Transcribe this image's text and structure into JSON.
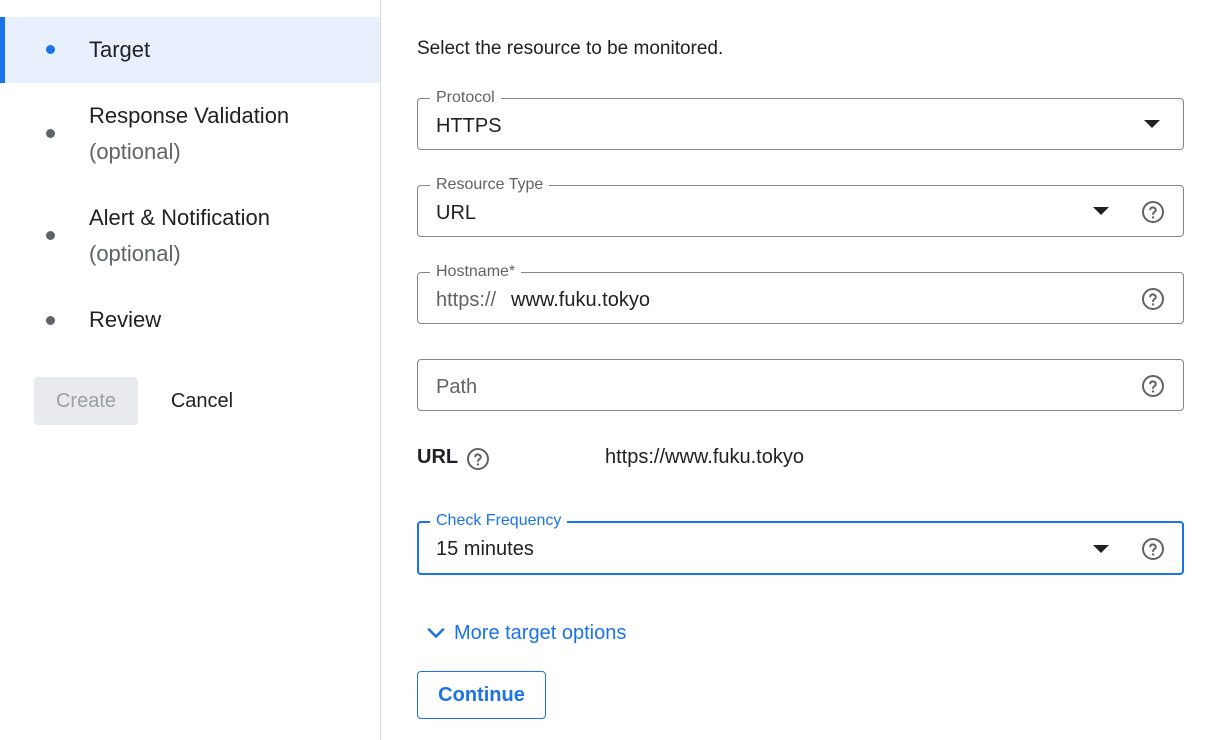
{
  "sidebar": {
    "steps": [
      {
        "title": "Target",
        "subtitle": ""
      },
      {
        "title": "Response Validation",
        "subtitle": "(optional)"
      },
      {
        "title": "Alert & Notification",
        "subtitle": "(optional)"
      },
      {
        "title": "Review",
        "subtitle": ""
      }
    ],
    "create_label": "Create",
    "cancel_label": "Cancel"
  },
  "main": {
    "intro": "Select the resource to be monitored.",
    "protocol": {
      "label": "Protocol",
      "value": "HTTPS"
    },
    "resource_type": {
      "label": "Resource Type",
      "value": "URL"
    },
    "hostname": {
      "label": "Hostname*",
      "prefix": "https://",
      "value": "www.fuku.tokyo"
    },
    "path": {
      "placeholder": "Path"
    },
    "url": {
      "label": "URL",
      "value": "https://www.fuku.tokyo"
    },
    "check_frequency": {
      "label": "Check Frequency",
      "value": "15 minutes"
    },
    "more_options_label": "More target options",
    "continue_label": "Continue"
  },
  "colors": {
    "accent": "#1a73e8",
    "active_step_bg": "#e8f0fe",
    "border": "#80868b"
  },
  "icons": {
    "help": "help-circle-icon",
    "dropdown": "caret-down-icon",
    "expand": "chevron-down-icon"
  }
}
